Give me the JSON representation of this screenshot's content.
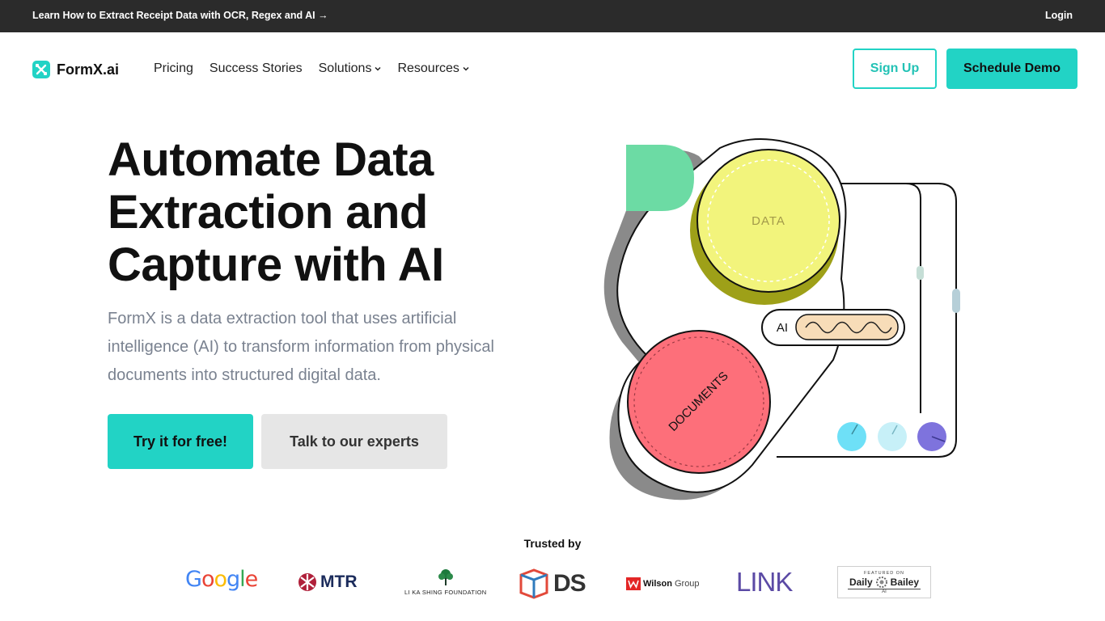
{
  "announcement": {
    "message": "Learn How to Extract Receipt Data with OCR, Regex and AI →",
    "login": "Login"
  },
  "nav": {
    "brand": "FormX.ai",
    "items": [
      {
        "label": "Pricing",
        "dropdown": false
      },
      {
        "label": "Success Stories",
        "dropdown": false
      },
      {
        "label": "Solutions",
        "dropdown": true
      },
      {
        "label": "Resources",
        "dropdown": true
      }
    ],
    "sign_up": "Sign Up",
    "schedule_demo": "Schedule Demo"
  },
  "hero": {
    "title_lines": [
      "Automate Data",
      "Extraction and",
      "Capture with AI"
    ],
    "subtitle_lines": [
      "FormX is a data extraction tool that uses artificial",
      "intelligence (AI) to transform information from physical",
      "documents into structured digital data."
    ],
    "cta_primary": "Try it for free!",
    "cta_secondary": "Talk to our experts"
  },
  "illustration": {
    "data_label": "DATA",
    "ai_label": "AI",
    "documents_label": "DOCUMENTS"
  },
  "trusted": {
    "heading": "Trusted by",
    "logos": {
      "google": "Google",
      "mtr": "MTR",
      "lksf": "LI KA SHING FOUNDATION",
      "ds": "DS",
      "wilson_brand": "Wilson",
      "wilson_group": "Group",
      "link": "LINK",
      "dailybailey_top": "FEATURED ON",
      "dailybailey_left": "Daily",
      "dailybailey_right": "Bailey",
      "dailybailey_bottom": "AI"
    }
  },
  "colors": {
    "accent": "#22d3c5",
    "topbar": "#2b2b2b",
    "data_circle": "#f2f47c",
    "documents_circle": "#fd6f7a",
    "green_shape": "#6cdba4"
  }
}
